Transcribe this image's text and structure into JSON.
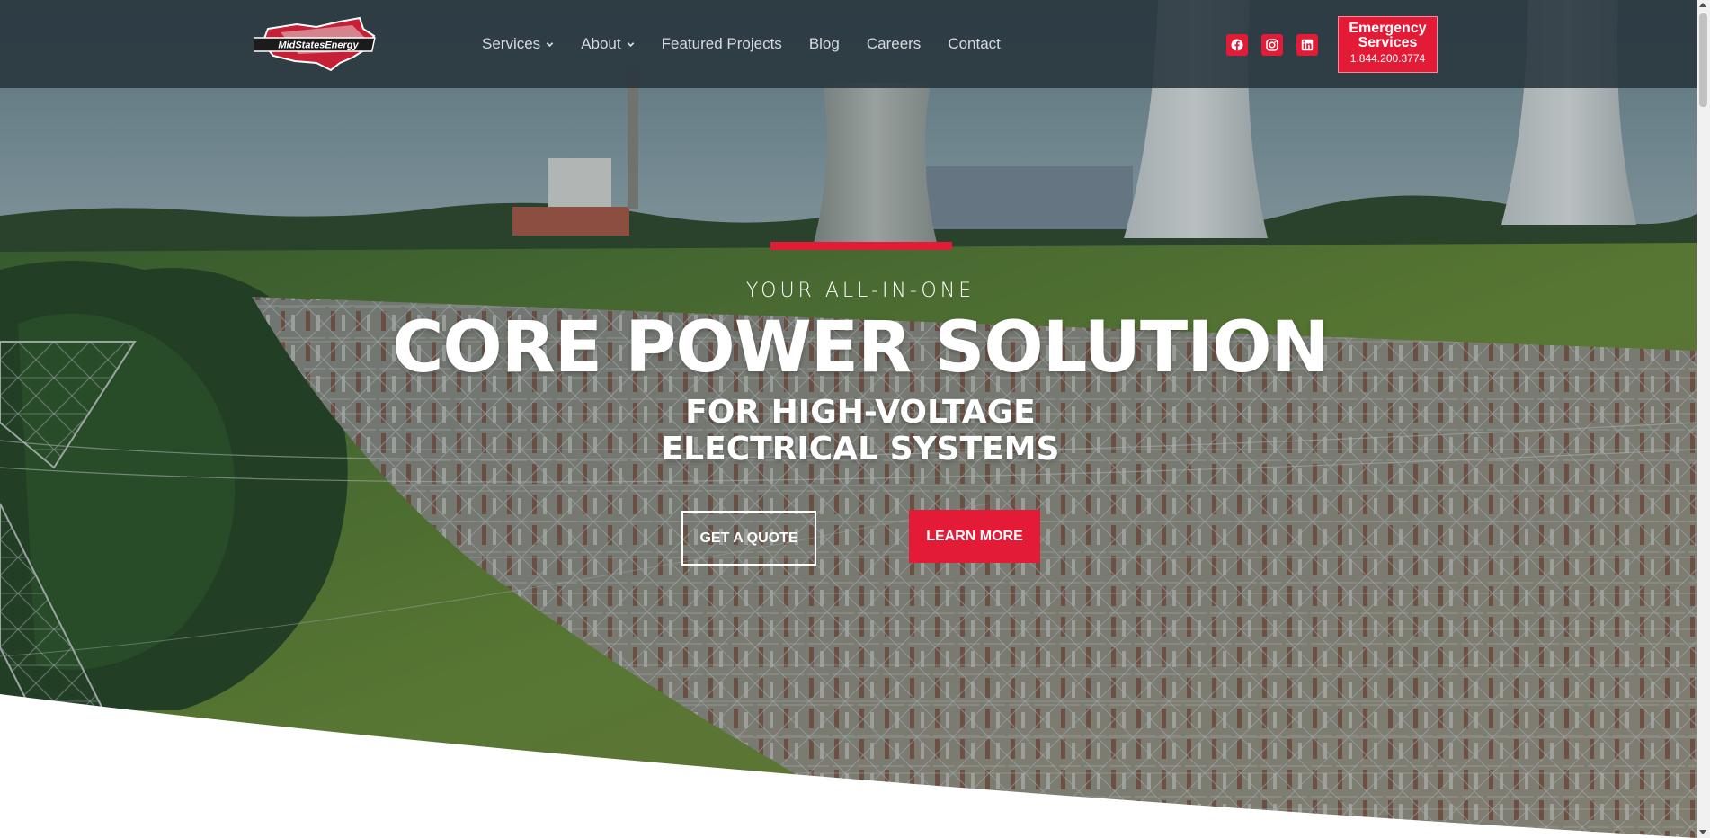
{
  "header": {
    "logo_text": "MidStatesEnergy",
    "nav": [
      {
        "label": "Services",
        "has_dropdown": true
      },
      {
        "label": "About",
        "has_dropdown": true
      },
      {
        "label": "Featured Projects",
        "has_dropdown": false
      },
      {
        "label": "Blog",
        "has_dropdown": false
      },
      {
        "label": "Careers",
        "has_dropdown": false
      },
      {
        "label": "Contact",
        "has_dropdown": false
      }
    ],
    "socials": [
      "facebook-icon",
      "instagram-icon",
      "linkedin-icon"
    ],
    "emergency": {
      "title": "Emergency Services",
      "phone": "1.844.200.3774"
    }
  },
  "hero": {
    "kicker": "YOUR ALL-IN-ONE",
    "headline": "CORE POWER SOLUTION",
    "sub_line1": "FOR HIGH-VOLTAGE",
    "sub_line2": "ELECTRICAL SYSTEMS",
    "quote_button": "GET A QUOTE",
    "learn_button": "LEARN MORE"
  },
  "colors": {
    "accent": "#e31b37",
    "header_bg": "#28343c",
    "text_light": "#ffffff"
  }
}
